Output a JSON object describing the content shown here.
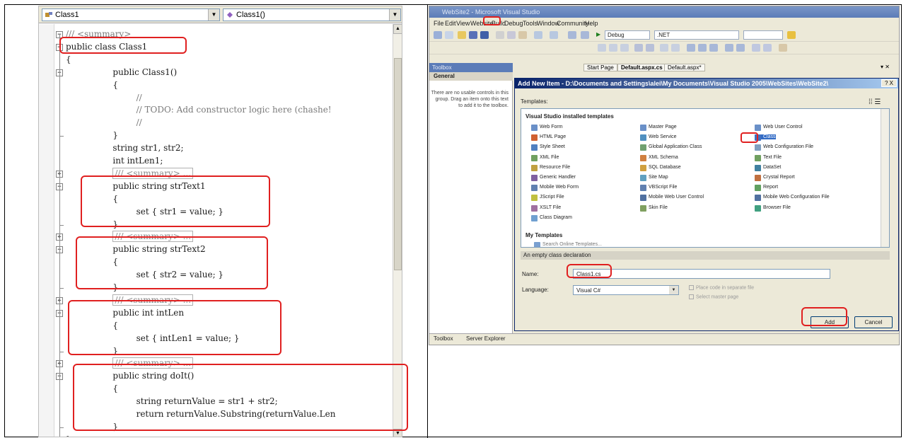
{
  "editor": {
    "class_combo": "Class1",
    "member_combo": "Class1()",
    "lines": [
      {
        "text": "/// <summary>",
        "cls": "cm"
      },
      {
        "text": "public class Class1",
        "cls": "kw"
      },
      {
        "text": "{",
        "cls": "kw"
      },
      {
        "text": "public Class1()",
        "cls": "kw"
      },
      {
        "text": "{",
        "cls": "kw"
      },
      {
        "text": "//",
        "cls": "cm"
      },
      {
        "text": "// TODO: Add constructor logic here (chashe!",
        "cls": "cm"
      },
      {
        "text": "//",
        "cls": "cm"
      },
      {
        "text": "}",
        "cls": "kw"
      },
      {
        "text": "string str1, str2;",
        "cls": "kw"
      },
      {
        "text": "int intLen1;",
        "cls": "kw"
      },
      {
        "text": "/// <summary> ...",
        "cls": "collapsed"
      },
      {
        "text": "public string strText1",
        "cls": "kw"
      },
      {
        "text": "{",
        "cls": "kw"
      },
      {
        "text": "set { str1 = value; }",
        "cls": "kw"
      },
      {
        "text": "}",
        "cls": "kw"
      },
      {
        "text": "/// <summary> ...",
        "cls": "collapsed"
      },
      {
        "text": "public string strText2",
        "cls": "kw"
      },
      {
        "text": "{",
        "cls": "kw"
      },
      {
        "text": "set { str2 = value; }",
        "cls": "kw"
      },
      {
        "text": "}",
        "cls": "kw"
      },
      {
        "text": "/// <summary> ...",
        "cls": "collapsed"
      },
      {
        "text": "public int intLen",
        "cls": "kw"
      },
      {
        "text": "{",
        "cls": "kw"
      },
      {
        "text": "set { intLen1 = value; }",
        "cls": "kw"
      },
      {
        "text": "}",
        "cls": "kw"
      },
      {
        "text": "/// <summary> ...",
        "cls": "collapsed"
      },
      {
        "text": "public string doIt()",
        "cls": "kw"
      },
      {
        "text": "{",
        "cls": "kw"
      },
      {
        "text": "string returnValue = str1 + str2;",
        "cls": "kw"
      },
      {
        "text": "return returnValue.Substring(returnValue.Len",
        "cls": "kw"
      },
      {
        "text": "}",
        "cls": "kw"
      },
      {
        "text": "}",
        "cls": "kw"
      }
    ]
  },
  "vs": {
    "title": "WebSite2 - Microsoft Visual Studio",
    "menu": [
      "File",
      "Edit",
      "View",
      "Website",
      "Build",
      "Debug",
      "Tools",
      "Window",
      "Community",
      "Help"
    ],
    "toolbar": {
      "config": "Debug",
      "platform": ".NET"
    },
    "toolbox": {
      "header": "Toolbox",
      "group": "General",
      "empty_text": "There are no usable controls in this group. Drag an item onto this text to add it to the toolbox."
    },
    "doc_tabs": [
      "Start Page",
      "Default.aspx.cs",
      "Default.aspx*"
    ],
    "bottom_tabs": [
      "Toolbox",
      "Server Explorer"
    ],
    "dialog": {
      "title": "Add New Item - D:\\Documents and Settings\\alei\\My Documents\\Visual Studio 2005\\WebSites\\WebSite2\\",
      "help": "? X",
      "templates_label": "Templates:",
      "installed_header": "Visual Studio installed templates",
      "templates_col1": [
        "Web Form",
        "HTML Page",
        "Style Sheet",
        "XML File",
        "Resource File",
        "Generic Handler",
        "Mobile Web Form",
        "JScript File",
        "XSLT File",
        "Class Diagram"
      ],
      "templates_col2": [
        "Master Page",
        "Web Service",
        "Global Application Class",
        "XML Schema",
        "SQL Database",
        "Site Map",
        "VBScript File",
        "Mobile Web User Control",
        "Skin File"
      ],
      "templates_col3": [
        "Web User Control",
        "Class",
        "Web Configuration File",
        "Text File",
        "DataSet",
        "Crystal Report",
        "Report",
        "Mobile Web Configuration File",
        "Browser File"
      ],
      "my_templates_header": "My Templates",
      "search_online": "Search Online Templates...",
      "description": "An empty class declaration",
      "name_label": "Name:",
      "name_value": "Class1.cs",
      "language_label": "Language:",
      "language_value": "Visual C#",
      "place_code": "Place code in separate file",
      "select_master": "Select master page",
      "add_button": "Add",
      "cancel_button": "Cancel"
    }
  },
  "colors": {
    "highlight": "#e02020",
    "title_blue": "#0a246a"
  }
}
